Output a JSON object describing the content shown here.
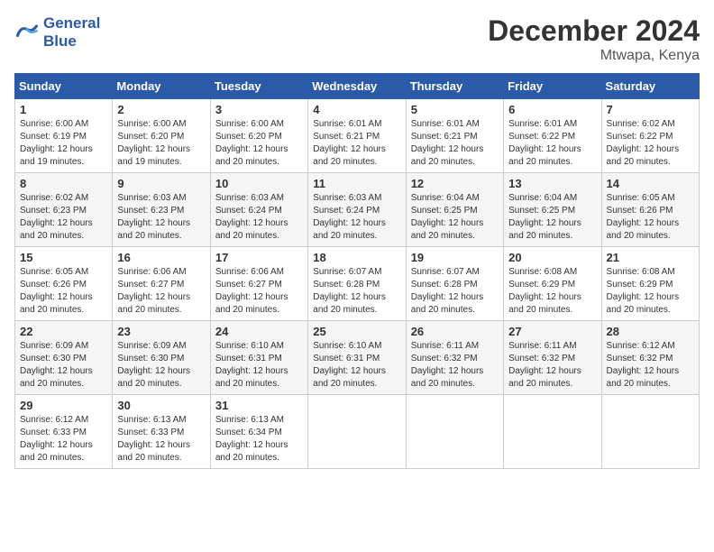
{
  "header": {
    "logo_line1": "General",
    "logo_line2": "Blue",
    "month": "December 2024",
    "location": "Mtwapa, Kenya"
  },
  "weekdays": [
    "Sunday",
    "Monday",
    "Tuesday",
    "Wednesday",
    "Thursday",
    "Friday",
    "Saturday"
  ],
  "weeks": [
    [
      {
        "day": "1",
        "info": "Sunrise: 6:00 AM\nSunset: 6:19 PM\nDaylight: 12 hours\nand 19 minutes."
      },
      {
        "day": "2",
        "info": "Sunrise: 6:00 AM\nSunset: 6:20 PM\nDaylight: 12 hours\nand 19 minutes."
      },
      {
        "day": "3",
        "info": "Sunrise: 6:00 AM\nSunset: 6:20 PM\nDaylight: 12 hours\nand 20 minutes."
      },
      {
        "day": "4",
        "info": "Sunrise: 6:01 AM\nSunset: 6:21 PM\nDaylight: 12 hours\nand 20 minutes."
      },
      {
        "day": "5",
        "info": "Sunrise: 6:01 AM\nSunset: 6:21 PM\nDaylight: 12 hours\nand 20 minutes."
      },
      {
        "day": "6",
        "info": "Sunrise: 6:01 AM\nSunset: 6:22 PM\nDaylight: 12 hours\nand 20 minutes."
      },
      {
        "day": "7",
        "info": "Sunrise: 6:02 AM\nSunset: 6:22 PM\nDaylight: 12 hours\nand 20 minutes."
      }
    ],
    [
      {
        "day": "8",
        "info": "Sunrise: 6:02 AM\nSunset: 6:23 PM\nDaylight: 12 hours\nand 20 minutes."
      },
      {
        "day": "9",
        "info": "Sunrise: 6:03 AM\nSunset: 6:23 PM\nDaylight: 12 hours\nand 20 minutes."
      },
      {
        "day": "10",
        "info": "Sunrise: 6:03 AM\nSunset: 6:24 PM\nDaylight: 12 hours\nand 20 minutes."
      },
      {
        "day": "11",
        "info": "Sunrise: 6:03 AM\nSunset: 6:24 PM\nDaylight: 12 hours\nand 20 minutes."
      },
      {
        "day": "12",
        "info": "Sunrise: 6:04 AM\nSunset: 6:25 PM\nDaylight: 12 hours\nand 20 minutes."
      },
      {
        "day": "13",
        "info": "Sunrise: 6:04 AM\nSunset: 6:25 PM\nDaylight: 12 hours\nand 20 minutes."
      },
      {
        "day": "14",
        "info": "Sunrise: 6:05 AM\nSunset: 6:26 PM\nDaylight: 12 hours\nand 20 minutes."
      }
    ],
    [
      {
        "day": "15",
        "info": "Sunrise: 6:05 AM\nSunset: 6:26 PM\nDaylight: 12 hours\nand 20 minutes."
      },
      {
        "day": "16",
        "info": "Sunrise: 6:06 AM\nSunset: 6:27 PM\nDaylight: 12 hours\nand 20 minutes."
      },
      {
        "day": "17",
        "info": "Sunrise: 6:06 AM\nSunset: 6:27 PM\nDaylight: 12 hours\nand 20 minutes."
      },
      {
        "day": "18",
        "info": "Sunrise: 6:07 AM\nSunset: 6:28 PM\nDaylight: 12 hours\nand 20 minutes."
      },
      {
        "day": "19",
        "info": "Sunrise: 6:07 AM\nSunset: 6:28 PM\nDaylight: 12 hours\nand 20 minutes."
      },
      {
        "day": "20",
        "info": "Sunrise: 6:08 AM\nSunset: 6:29 PM\nDaylight: 12 hours\nand 20 minutes."
      },
      {
        "day": "21",
        "info": "Sunrise: 6:08 AM\nSunset: 6:29 PM\nDaylight: 12 hours\nand 20 minutes."
      }
    ],
    [
      {
        "day": "22",
        "info": "Sunrise: 6:09 AM\nSunset: 6:30 PM\nDaylight: 12 hours\nand 20 minutes."
      },
      {
        "day": "23",
        "info": "Sunrise: 6:09 AM\nSunset: 6:30 PM\nDaylight: 12 hours\nand 20 minutes."
      },
      {
        "day": "24",
        "info": "Sunrise: 6:10 AM\nSunset: 6:31 PM\nDaylight: 12 hours\nand 20 minutes."
      },
      {
        "day": "25",
        "info": "Sunrise: 6:10 AM\nSunset: 6:31 PM\nDaylight: 12 hours\nand 20 minutes."
      },
      {
        "day": "26",
        "info": "Sunrise: 6:11 AM\nSunset: 6:32 PM\nDaylight: 12 hours\nand 20 minutes."
      },
      {
        "day": "27",
        "info": "Sunrise: 6:11 AM\nSunset: 6:32 PM\nDaylight: 12 hours\nand 20 minutes."
      },
      {
        "day": "28",
        "info": "Sunrise: 6:12 AM\nSunset: 6:32 PM\nDaylight: 12 hours\nand 20 minutes."
      }
    ],
    [
      {
        "day": "29",
        "info": "Sunrise: 6:12 AM\nSunset: 6:33 PM\nDaylight: 12 hours\nand 20 minutes."
      },
      {
        "day": "30",
        "info": "Sunrise: 6:13 AM\nSunset: 6:33 PM\nDaylight: 12 hours\nand 20 minutes."
      },
      {
        "day": "31",
        "info": "Sunrise: 6:13 AM\nSunset: 6:34 PM\nDaylight: 12 hours\nand 20 minutes."
      },
      null,
      null,
      null,
      null
    ]
  ]
}
